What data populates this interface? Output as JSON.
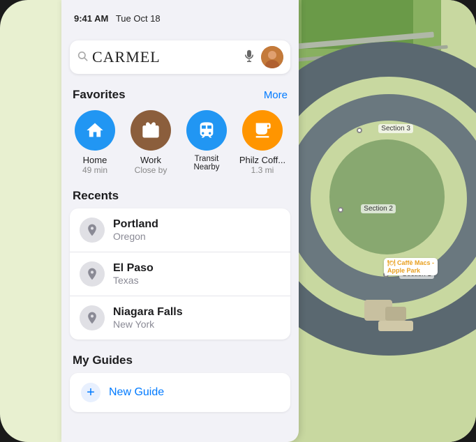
{
  "status_bar": {
    "time": "9:41 AM",
    "date": "Tue Oct 18"
  },
  "search": {
    "placeholder": "Search",
    "current_value": "CARMEL",
    "mic_label": "microphone",
    "avatar_label": "user avatar"
  },
  "favorites": {
    "section_title": "Favorites",
    "more_label": "More",
    "items": [
      {
        "id": "home",
        "label": "Home",
        "sublabel": "49 min",
        "icon": "home"
      },
      {
        "id": "work",
        "label": "Work",
        "sublabel": "Close by",
        "icon": "work"
      },
      {
        "id": "transit",
        "label": "Transit Nearby",
        "sublabel": "",
        "icon": "transit"
      },
      {
        "id": "coffee",
        "label": "Philz Coff...",
        "sublabel": "1.3 mi",
        "icon": "coffee"
      }
    ]
  },
  "recents": {
    "section_title": "Recents",
    "items": [
      {
        "name": "Portland",
        "sub": "Oregon"
      },
      {
        "name": "El Paso",
        "sub": "Texas"
      },
      {
        "name": "Niagara Falls",
        "sub": "New York"
      }
    ]
  },
  "guides": {
    "section_title": "My Guides",
    "new_guide_label": "New Guide"
  },
  "map": {
    "labels": [
      {
        "text": "Section 3",
        "id": "section3"
      },
      {
        "text": "Section 2",
        "id": "section2"
      },
      {
        "text": "Section 1",
        "id": "section1"
      }
    ],
    "poi": "Caffè Macs -\nApple Park"
  }
}
